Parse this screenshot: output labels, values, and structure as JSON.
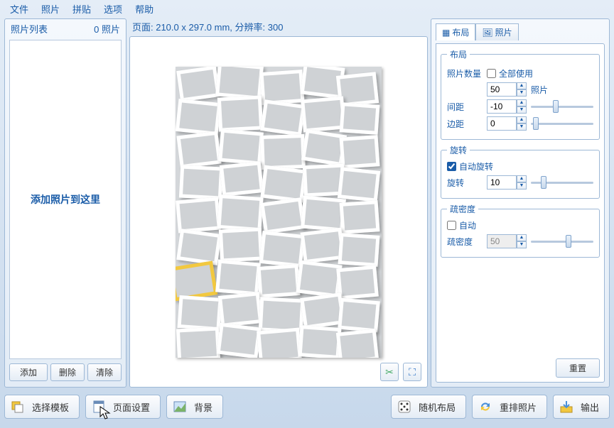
{
  "menu": {
    "file": "文件",
    "photo": "照片",
    "collage": "拼贴",
    "options": "选项",
    "help": "帮助"
  },
  "left": {
    "title": "照片列表",
    "count": "0 照片",
    "dropzone": "添加照片到这里",
    "add": "添加",
    "delete": "删除",
    "clear": "清除"
  },
  "center": {
    "pageinfo": "页面: 210.0 x 297.0 mm, 分辨率: 300"
  },
  "tabs": {
    "layout": "布局",
    "photo": "照片"
  },
  "layout": {
    "legend": "布局",
    "count_label": "照片数量",
    "use_all": "全部使用",
    "count_value": "50",
    "count_after": "照片",
    "spacing_label": "间距",
    "spacing_value": "-10",
    "margin_label": "边距",
    "margin_value": "0"
  },
  "rotation": {
    "legend": "旋转",
    "auto": "自动旋转",
    "label": "旋转",
    "value": "10"
  },
  "density": {
    "legend": "疏密度",
    "auto": "自动",
    "label": "疏密度",
    "value": "50"
  },
  "reset": "重置",
  "bottom": {
    "template": "选择模板",
    "page": "页面设置",
    "background": "背景",
    "shuffle": "随机布局",
    "rearrange": "重排照片",
    "export": "输出"
  },
  "sliders": {
    "spacing_pct": 40,
    "margin_pct": 8,
    "rotation_pct": 20,
    "density_pct": 60
  }
}
